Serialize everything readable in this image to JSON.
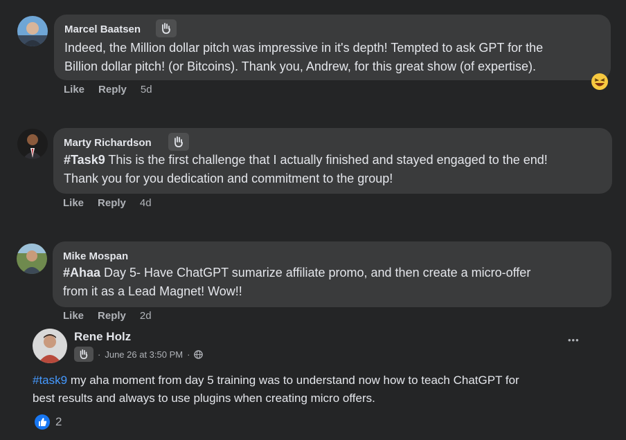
{
  "comments": [
    {
      "author": "Marcel Baatsen",
      "line1": "Indeed, the Million dollar pitch was impressive in it's depth! Tempted to ask GPT for the",
      "line2": "Billion dollar pitch! (or Bitcoins). Thank you, Andrew, for this great show (of expertise).",
      "like": "Like",
      "reply": "Reply",
      "time": "5d",
      "badge_icon": "waving-hand-icon",
      "reaction_icon": "laughing-emoji-icon"
    },
    {
      "author": "Marty Richardson",
      "tag": "#Task9",
      "line1": " This is the first challenge that I actually finished and stayed engaged to the end!",
      "line2": "Thank you for you dedication and commitment to the group!",
      "like": "Like",
      "reply": "Reply",
      "time": "4d",
      "badge_icon": "waving-hand-icon"
    },
    {
      "author": "Mike Mospan",
      "tag": "#Ahaa",
      "line1": " Day 5- Have ChatGPT sumarize affiliate promo, and then create a micro-offer",
      "line2": "from it as a Lead Magnet! Wow!!",
      "like": "Like",
      "reply": "Reply",
      "time": "2d"
    }
  ],
  "post": {
    "author": "Rene Holz",
    "date": "June 26 at 3:50 PM",
    "separator": "·",
    "audience_icon": "globe-icon",
    "more": "•••",
    "hashtag": "#task9",
    "line1": " my aha moment from day 5 training was to understand now how to teach ChatGPT for",
    "line2": "best results and always to use plugins when creating micro offers.",
    "like_count": "2",
    "like_icon": "thumbs-up-icon"
  },
  "colors": {
    "background": "#242526",
    "bubble": "#3a3b3c",
    "hashtag": "#4599ff",
    "like_blue": "#1877f2"
  }
}
